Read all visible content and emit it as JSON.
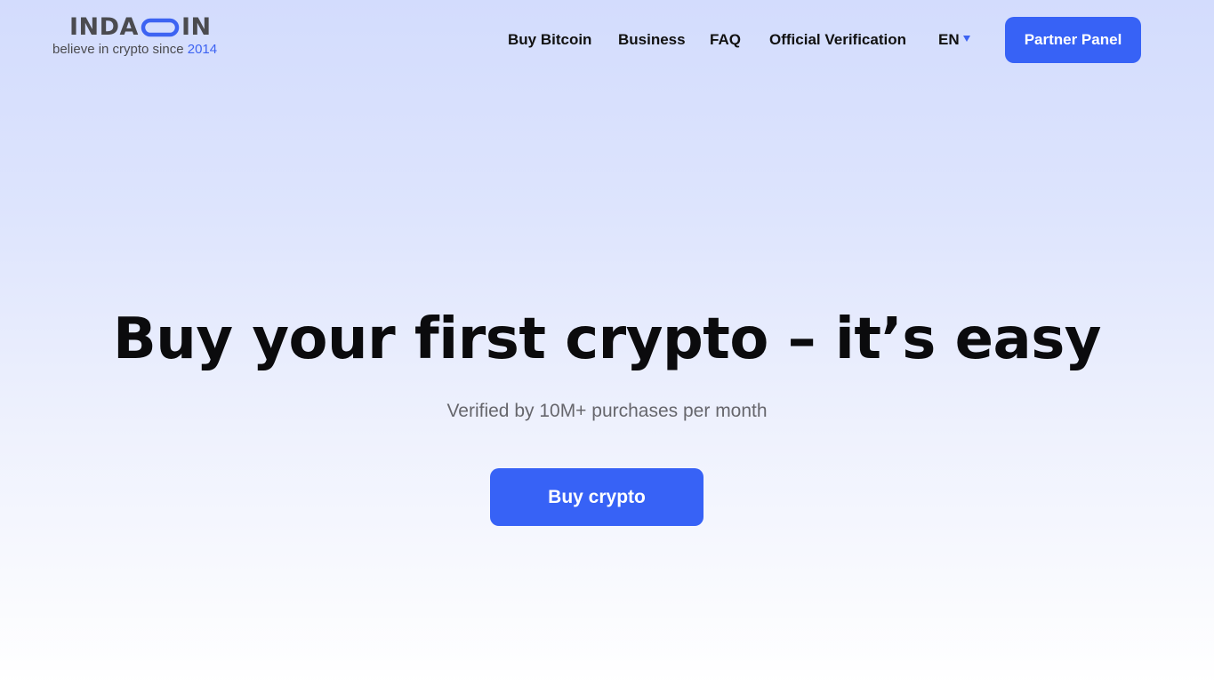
{
  "brand": {
    "word_left": "INDA",
    "word_right": "IN",
    "tagline": "believe in crypto since ",
    "tagline_year": "2014",
    "colors": {
      "text": "#4b4b4f",
      "accent": "#3d63f2"
    }
  },
  "nav": {
    "items": [
      {
        "label": "Buy Bitcoin"
      },
      {
        "label": "Business"
      },
      {
        "label": "FAQ"
      },
      {
        "label": "Official Verification"
      }
    ],
    "language": "EN",
    "partner_button": "Partner Panel"
  },
  "hero": {
    "title": "Buy your first crypto – it’s easy",
    "subtitle": "Verified by 10M+ purchases per month",
    "cta": "Buy crypto"
  },
  "colors": {
    "primary_button": "#3762f6",
    "background_top": "#d3dcfd",
    "background_bottom": "#ffffff"
  }
}
